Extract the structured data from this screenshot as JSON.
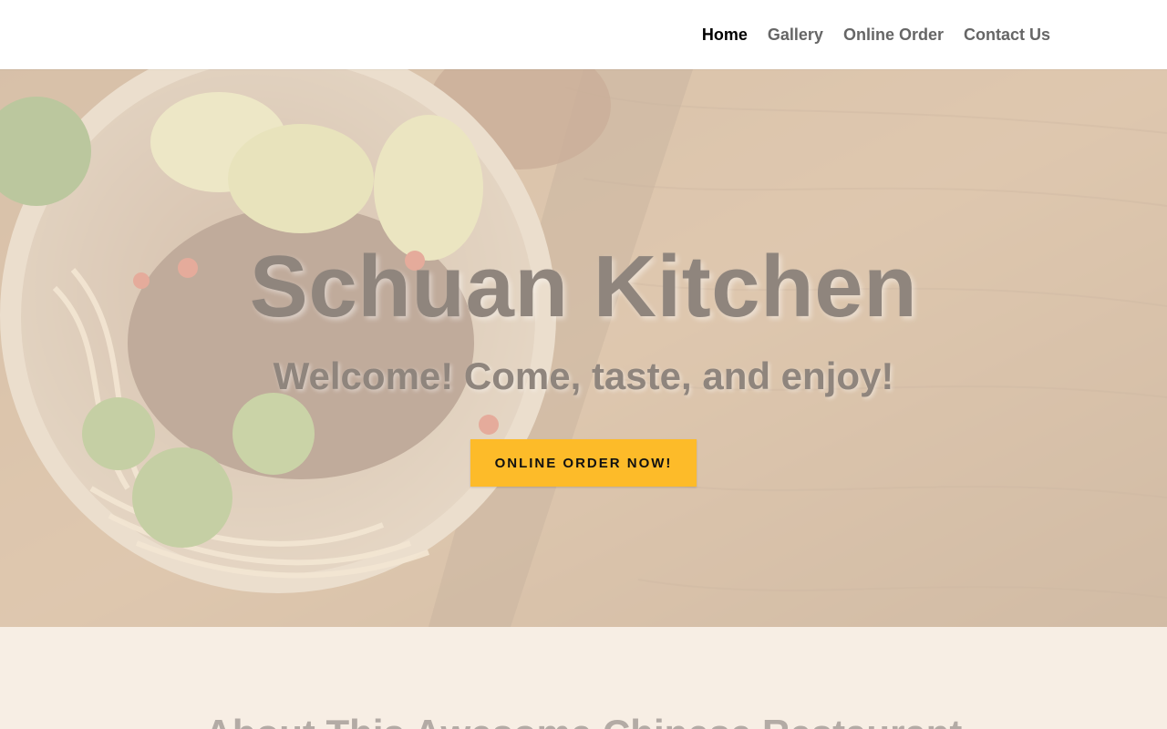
{
  "nav": {
    "items": [
      {
        "label": "Home",
        "active": true
      },
      {
        "label": "Gallery",
        "active": false
      },
      {
        "label": "Online Order",
        "active": false
      },
      {
        "label": "Contact Us",
        "active": false
      }
    ]
  },
  "hero": {
    "title": "Schuan Kitchen",
    "subtitle": "Welcome! Come, taste, and enjoy!",
    "cta_label": "ONLINE ORDER NOW!",
    "cta_color": "#fdbb29"
  },
  "about": {
    "heading": "About This Awesome Chinese Restaurant"
  }
}
